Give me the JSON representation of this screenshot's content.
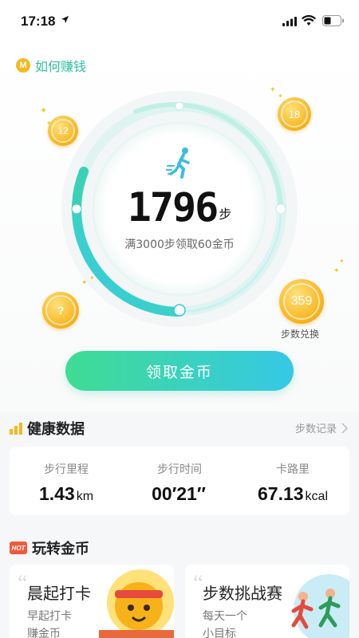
{
  "status_bar": {
    "time": "17:18"
  },
  "header": {
    "how_to_earn": "如何赚钱",
    "coin_badge": "M"
  },
  "pedometer": {
    "steps": "1796",
    "steps_unit": "步",
    "goal_text": "满3000步领取60金币",
    "progress_fraction": 0.6
  },
  "coins": [
    {
      "value": "12"
    },
    {
      "value": "18"
    },
    {
      "value": "?"
    },
    {
      "value": "359",
      "label": "步数兑换"
    }
  ],
  "claim_button": "领取金币",
  "health": {
    "title": "健康数据",
    "record_link": "步数记录",
    "stats": [
      {
        "label": "步行里程",
        "value": "1.43",
        "unit": "km"
      },
      {
        "label": "步行时间",
        "value": "00′21″",
        "unit": ""
      },
      {
        "label": "卡路里",
        "value": "67.13",
        "unit": "kcal"
      }
    ]
  },
  "play": {
    "title": "玩转金币",
    "hot_badge": "HOT",
    "tasks": [
      {
        "title": "晨起打卡",
        "line1": "早起打卡",
        "line2": "赚金币"
      },
      {
        "title": "步数挑战赛",
        "line1": "每天一个",
        "line2": "小目标"
      }
    ]
  },
  "colors": {
    "accent_green": "#3fdc93",
    "accent_cyan": "#36c8e6",
    "coin_gold": "#f7b21a",
    "link_teal": "#2fc0a4"
  }
}
